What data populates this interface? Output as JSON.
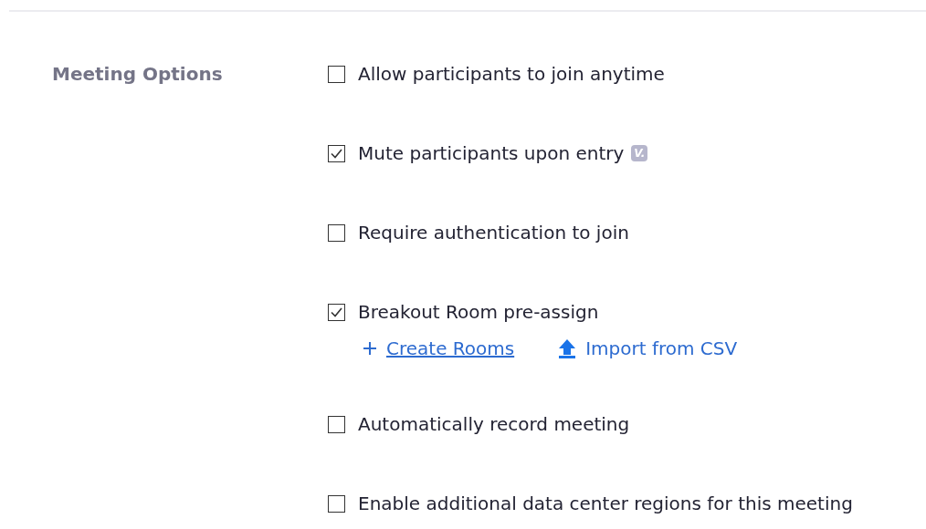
{
  "section": {
    "label": "Meeting Options"
  },
  "options": [
    {
      "label": "Allow participants to join anytime",
      "checked": false
    },
    {
      "label": "Mute participants upon entry",
      "checked": true,
      "badge": "V."
    },
    {
      "label": "Require authentication to join",
      "checked": false
    },
    {
      "label": "Breakout Room pre-assign",
      "checked": true,
      "links": [
        {
          "kind": "create",
          "label": "Create Rooms"
        },
        {
          "kind": "import",
          "label": "Import from CSV"
        }
      ]
    },
    {
      "label": "Automatically record meeting",
      "checked": false
    },
    {
      "label": "Enable additional data center regions for this meeting",
      "checked": false
    }
  ]
}
